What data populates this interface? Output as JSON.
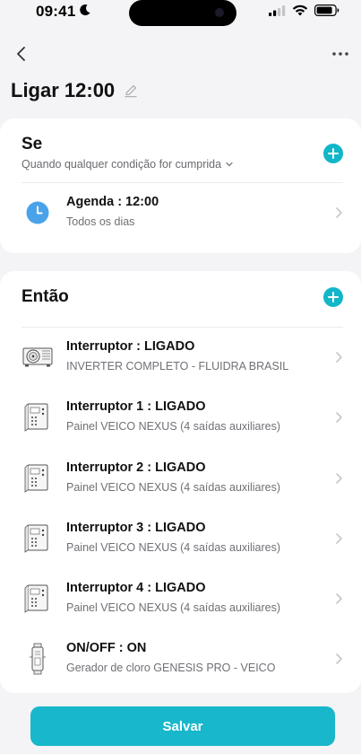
{
  "status_bar": {
    "time": "09:41"
  },
  "header": {
    "title": "Ligar 12:00"
  },
  "if_section": {
    "heading": "Se",
    "condition_mode": "Quando qualquer condição for cumprida",
    "conditions": [
      {
        "title": "Agenda : 12:00",
        "subtitle": "Todos os dias",
        "icon": "clock-icon"
      }
    ]
  },
  "then_section": {
    "heading": "Então",
    "actions": [
      {
        "title": "Interruptor : LIGADO",
        "subtitle": "INVERTER COMPLETO - FLUIDRA BRASIL",
        "icon": "heat-pump-icon"
      },
      {
        "title": "Interruptor 1 : LIGADO",
        "subtitle": "Painel VEICO NEXUS (4 saídas auxiliares)",
        "icon": "control-panel-icon"
      },
      {
        "title": "Interruptor 2 : LIGADO",
        "subtitle": "Painel VEICO NEXUS (4 saídas auxiliares)",
        "icon": "control-panel-icon"
      },
      {
        "title": "Interruptor 3 : LIGADO",
        "subtitle": "Painel VEICO NEXUS (4 saídas auxiliares)",
        "icon": "control-panel-icon"
      },
      {
        "title": "Interruptor 4 : LIGADO",
        "subtitle": "Painel VEICO NEXUS (4 saídas auxiliares)",
        "icon": "control-panel-icon"
      },
      {
        "title": "ON/OFF : ON",
        "subtitle": "Gerador de cloro GENESIS PRO - VEICO",
        "icon": "chlorinator-icon"
      }
    ]
  },
  "footer": {
    "save_label": "Salvar"
  },
  "colors": {
    "accent": "#18b7cb",
    "clock_blue": "#4aa3e8",
    "background": "#f4f4f6"
  }
}
